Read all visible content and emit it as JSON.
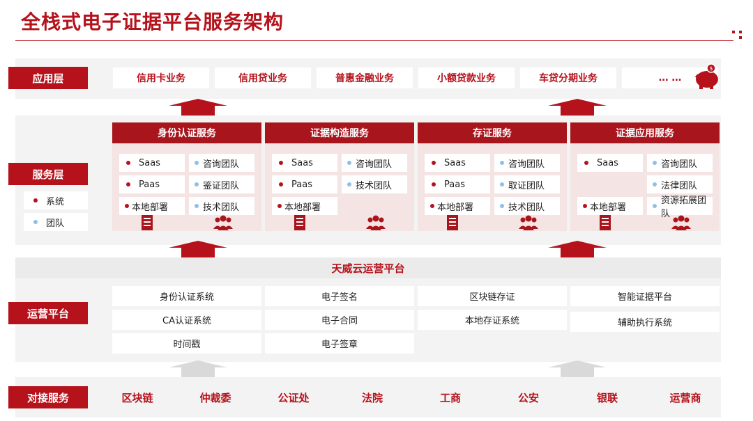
{
  "title": "全栈式电子证据平台服务架构",
  "colors": {
    "accent": "#b5121b",
    "team_dot": "#8fbfe6",
    "band": "#f3f3f3",
    "service_bg": "#f5e4e4"
  },
  "app_layer": {
    "label": "应用层",
    "items": [
      "信用卡业务",
      "信用贷业务",
      "普惠金融业务",
      "小额贷款业务",
      "车贷分期业务",
      "… …"
    ],
    "icon": "piggy-bank-icon"
  },
  "service_layer": {
    "label": "服务层",
    "legend": {
      "system": "系统",
      "team": "团队"
    },
    "columns": [
      {
        "title": "身份认证服务",
        "systems": [
          "Saas",
          "Paas",
          "本地部署"
        ],
        "teams": [
          "咨询团队",
          "鉴证团队",
          "技术团队"
        ]
      },
      {
        "title": "证据构造服务",
        "systems": [
          "Saas",
          "Paas",
          "本地部署"
        ],
        "teams": [
          "咨询团队",
          "技术团队"
        ]
      },
      {
        "title": "存证服务",
        "systems": [
          "Saas",
          "Paas",
          "本地部署"
        ],
        "teams": [
          "咨询团队",
          "取证团队",
          "技术团队"
        ]
      },
      {
        "title": "证据应用服务",
        "systems": [
          "Saas",
          "本地部署"
        ],
        "teams": [
          "咨询团队",
          "法律团队",
          "资源拓展团队"
        ]
      }
    ],
    "icons": {
      "server": "server-icon",
      "team": "team-icon"
    }
  },
  "ops_platform": {
    "label": "运营平台",
    "header": "天威云运营平台",
    "columns": [
      [
        "身份认证系统",
        "CA认证系统",
        "时间戳"
      ],
      [
        "电子签名",
        "电子合同",
        "电子签章"
      ],
      [
        "区块链存证",
        "本地存证系统"
      ],
      [
        "智能证据平台",
        "辅助执行系统"
      ]
    ]
  },
  "partners": {
    "label": "对接服务",
    "items": [
      "区块链",
      "仲裁委",
      "公证处",
      "法院",
      "工商",
      "公安",
      "银联",
      "运营商"
    ]
  }
}
